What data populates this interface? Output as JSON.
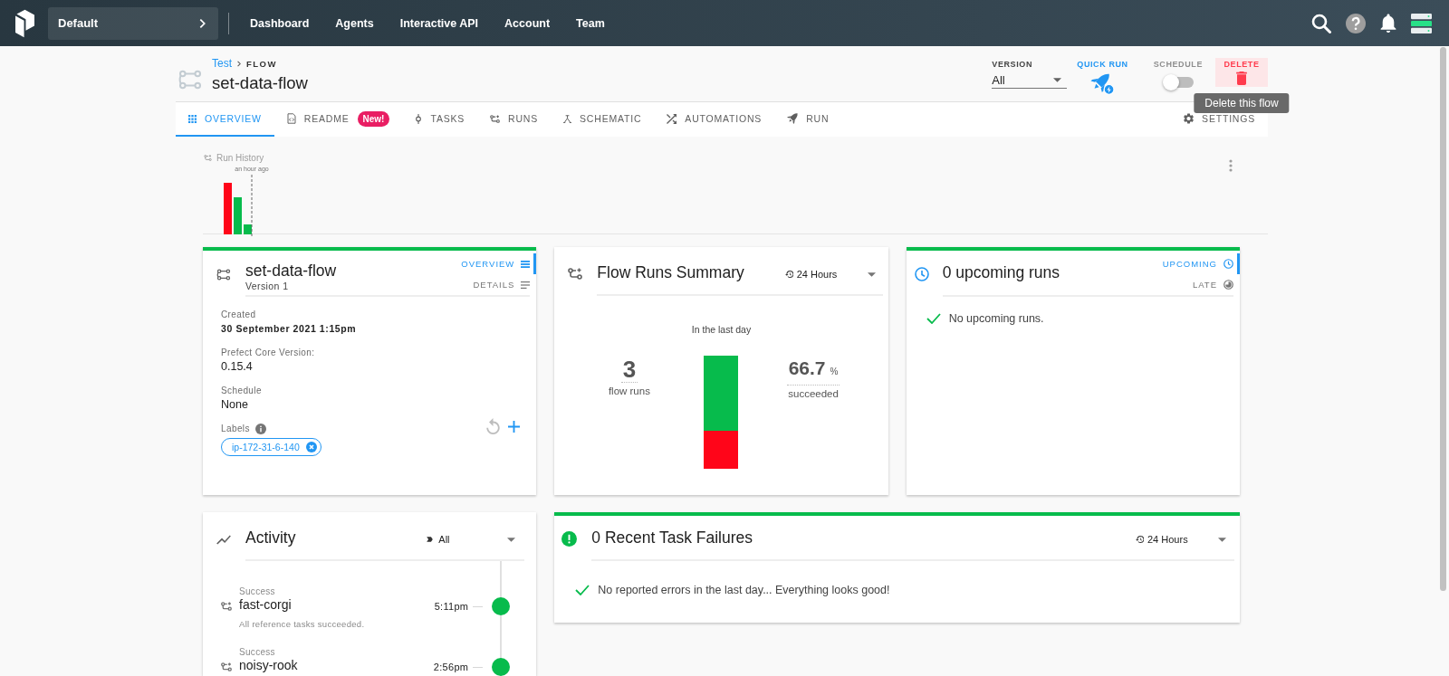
{
  "top_bar": {
    "team": "Default",
    "nav": [
      {
        "label": "Dashboard",
        "selected": false
      },
      {
        "label": "Agents",
        "selected": false
      },
      {
        "label": "Interactive API",
        "selected": false
      },
      {
        "label": "Account",
        "selected": false
      },
      {
        "label": "Team",
        "selected": false
      }
    ]
  },
  "header": {
    "breadcrumb": {
      "parent": "Test",
      "current": "FLOW"
    },
    "title": "set-data-flow",
    "version": {
      "label": "VERSION",
      "value": "All"
    },
    "quick_run": {
      "label": "QUICK RUN"
    },
    "schedule": {
      "label": "SCHEDULE",
      "on": false
    },
    "delete": {
      "label": "DELETE",
      "tooltip": "Delete this flow"
    }
  },
  "tabs": [
    {
      "label": "OVERVIEW",
      "selected": true
    },
    {
      "label": "README",
      "badge": "New!",
      "selected": false
    },
    {
      "label": "TASKS",
      "selected": false
    },
    {
      "label": "RUNS",
      "selected": false
    },
    {
      "label": "SCHEMATIC",
      "selected": false
    },
    {
      "label": "AUTOMATIONS",
      "selected": false
    },
    {
      "label": "RUN",
      "selected": false
    }
  ],
  "settings_tab": {
    "label": "SETTINGS",
    "selected": false
  },
  "run_history": {
    "title": "Run History",
    "marker_label": "an hour ago",
    "bars": [
      {
        "color": "#ff0519"
      },
      {
        "color": "#07bb4c"
      },
      {
        "color": "#07bb4c"
      }
    ]
  },
  "flow_card": {
    "healthy": true,
    "title": "set-data-flow",
    "subtitle": "Version 1",
    "views": [
      {
        "label": "OVERVIEW",
        "selected": true
      },
      {
        "label": "DETAILS",
        "selected": false
      }
    ],
    "fields": [
      {
        "kind": "timestamp",
        "label": "Created",
        "value": "30 September 2021 1:15pm"
      },
      {
        "kind": "text",
        "label": "Prefect Core Version:",
        "value": "0.15.4"
      },
      {
        "kind": "text",
        "label": "Schedule",
        "value": "None"
      }
    ],
    "labels_title": "Labels",
    "labels": [
      "ip-172-31-6-140"
    ]
  },
  "runs_summary": {
    "title": "Flow Runs Summary",
    "range": "24 Hours",
    "caption": "In the last day",
    "count": "3",
    "count_label": "flow runs",
    "success_rate": "66.7",
    "unit": "%",
    "rate_label": "succeeded",
    "level": 0.667
  },
  "upcoming_card": {
    "healthy": true,
    "title": "0 upcoming runs",
    "views": [
      {
        "label": "UPCOMING",
        "selected": true
      },
      {
        "label": "LATE",
        "selected": false
      }
    ],
    "message": "No upcoming runs."
  },
  "activity": {
    "title": "Activity",
    "filter": "All",
    "items": [
      {
        "state": "Success",
        "name": "fast-corgi",
        "message": "All reference tasks succeeded.",
        "time": "5:11pm",
        "color": "#07bb4c"
      },
      {
        "state": "Success",
        "name": "noisy-rook",
        "time": "2:56pm",
        "color": "#07bb4c"
      }
    ]
  },
  "task_failures": {
    "healthy": true,
    "title": "0 Recent Task Failures",
    "range": "24 Hours",
    "message": "No reported errors in the last day... Everything looks good!"
  }
}
